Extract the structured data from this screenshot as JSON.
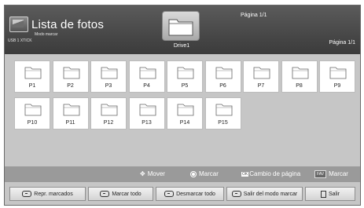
{
  "header": {
    "title": "Lista de fotos",
    "subtitle": "Modo marcar",
    "usb_label": "USB 1 XTICK",
    "drive_name": "Drive1",
    "page_top": "Página 1/1",
    "page_right": "Página 1/1"
  },
  "folders": [
    {
      "label": "P1"
    },
    {
      "label": "P2"
    },
    {
      "label": "P3"
    },
    {
      "label": "P4"
    },
    {
      "label": "P5"
    },
    {
      "label": "P6"
    },
    {
      "label": "P7"
    },
    {
      "label": "P8"
    },
    {
      "label": "P9"
    },
    {
      "label": "P10"
    },
    {
      "label": "P11"
    },
    {
      "label": "P12"
    },
    {
      "label": "P13"
    },
    {
      "label": "P14"
    },
    {
      "label": "P15"
    }
  ],
  "legend": {
    "move": "Mover",
    "mark": "Marcar",
    "ok_badge": "OK",
    "page_change": "Cambio de página",
    "fav_badge": "FAV",
    "fav_mark": "Marcar"
  },
  "buttons": {
    "repr": "Repr. marcados",
    "mark_all": "Marcar todo",
    "unmark_all": "Desmarcar todo",
    "exit_mark_mode": "Salir del modo marcar",
    "exit": "Salir"
  },
  "colors": {
    "header": "#4a4a4a",
    "body": "#c6c6c6",
    "legend": "#9a9a9a",
    "tile": "#ffffff"
  }
}
